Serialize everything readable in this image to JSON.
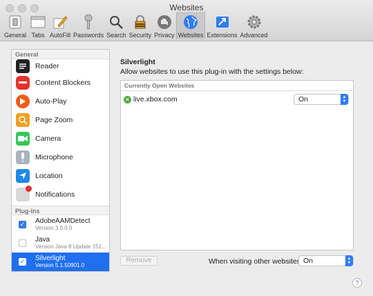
{
  "window": {
    "title": "Websites"
  },
  "toolbar": {
    "items": [
      {
        "label": "General",
        "icon": "general-switch-icon"
      },
      {
        "label": "Tabs",
        "icon": "tabs-icon"
      },
      {
        "label": "AutoFill",
        "icon": "autofill-pencil-icon"
      },
      {
        "label": "Passwords",
        "icon": "key-icon"
      },
      {
        "label": "Search",
        "icon": "search-icon"
      },
      {
        "label": "Security",
        "icon": "security-lock-icon"
      },
      {
        "label": "Privacy",
        "icon": "privacy-hand-icon"
      },
      {
        "label": "Websites",
        "icon": "globe-icon",
        "active": true
      },
      {
        "label": "Extensions",
        "icon": "extensions-puzzle-icon"
      },
      {
        "label": "Advanced",
        "icon": "gear-icon"
      }
    ]
  },
  "sidebar": {
    "general_header": "General",
    "general_items": [
      {
        "label": "Reader",
        "icon": "reader-icon",
        "color": "#222222"
      },
      {
        "label": "Content Blockers",
        "icon": "content-blockers-icon",
        "color": "#e5322d"
      },
      {
        "label": "Auto-Play",
        "icon": "auto-play-icon",
        "color": "#f05a1a"
      },
      {
        "label": "Page Zoom",
        "icon": "page-zoom-icon",
        "color": "#f0a020"
      },
      {
        "label": "Camera",
        "icon": "camera-icon",
        "color": "#34c759"
      },
      {
        "label": "Microphone",
        "icon": "microphone-icon",
        "color": "#a9b4c0"
      },
      {
        "label": "Location",
        "icon": "location-icon",
        "color": "#1e88e5"
      },
      {
        "label": "Notifications",
        "icon": "notifications-icon",
        "color": "#d8d8d8"
      }
    ],
    "plugins_header": "Plug-ins",
    "plugins": [
      {
        "name": "AdobeAAMDetect",
        "version": "Version 3.0.0.0",
        "checked": true
      },
      {
        "name": "Java",
        "version": "Version Java 8 Update 151...",
        "checked": false
      },
      {
        "name": "Silverlight",
        "version": "Version 5.1.50901.0",
        "checked": true,
        "selected": true
      }
    ]
  },
  "detail": {
    "title": "Silverlight",
    "subtitle": "Allow websites to use this plug-in with the settings below:",
    "open_websites_header": "Currently Open Websites",
    "sites": [
      {
        "host": "live.xbox.com",
        "setting": "On",
        "icon": "xbox-icon"
      }
    ],
    "remove_label": "Remove",
    "other_websites_label": "When visiting other websites:",
    "other_websites_value": "On",
    "help_label": "?"
  },
  "colors": {
    "accent": "#2f7df6",
    "selection": "#1f6ff0"
  }
}
